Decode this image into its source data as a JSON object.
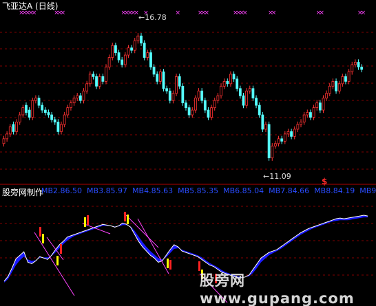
{
  "header": {
    "title": "飞亚达A (日线)"
  },
  "indicator": {
    "title": "股旁网制作",
    "mb_labels": [
      "MB2.86.50",
      "MB3.85.97",
      "MB4.85.63",
      "MB5.85.35",
      "MB6.85.04",
      "MB7.84.66",
      "MB8.84.19",
      "MB9"
    ]
  },
  "annotations": {
    "high": "16.78",
    "low": "11.09",
    "signal": "$"
  },
  "watermark": "股旁网 www.gupang.com",
  "colors": {
    "up": "#ff3333",
    "down": "#55ffff",
    "band_fill": "#1a1aff",
    "band_edge": "#ffffff",
    "signal_bar_red": "#ff2222",
    "signal_bar_yellow": "#ffff00",
    "slope_line": "#ff44ff",
    "marker": "#ff44ff",
    "grid": "#b00000"
  },
  "chart_data": [
    {
      "type": "candlestick",
      "title": "飞亚达A (日线)",
      "ylim": [
        10.7,
        17.6
      ],
      "grid": "dashed horizontal",
      "annotations": [
        {
          "text": "16.78",
          "x_index": 43,
          "y": 16.78
        },
        {
          "text": "11.09",
          "x_index": 83,
          "y": 11.09
        },
        {
          "text": "$",
          "x_index": 102
        }
      ],
      "top_markers_x_index": [
        5,
        6,
        7,
        8,
        9,
        16,
        17,
        18,
        37,
        38,
        39,
        40,
        41,
        44,
        54,
        61,
        62,
        63,
        72,
        73,
        74,
        75,
        83,
        84,
        98,
        99,
        111,
        112
      ],
      "close": [
        12.2,
        12.4,
        12.7,
        12.5,
        12.9,
        13.2,
        13.5,
        13.3,
        13.1,
        13.8,
        13.9,
        13.6,
        13.4,
        13.3,
        13.2,
        13.0,
        12.9,
        12.5,
        12.8,
        13.2,
        13.5,
        13.7,
        13.9,
        14.0,
        13.8,
        14.2,
        14.5,
        14.9,
        14.8,
        14.4,
        14.8,
        14.6,
        15.2,
        15.6,
        16.1,
        15.8,
        15.5,
        15.3,
        15.7,
        16.0,
        15.9,
        16.3,
        16.5,
        16.2,
        15.6,
        15.8,
        15.2,
        14.9,
        14.6,
        15.0,
        14.3,
        14.2,
        13.8,
        14.1,
        14.8,
        14.4,
        13.7,
        13.5,
        13.2,
        13.4,
        13.9,
        14.2,
        13.8,
        13.4,
        13.1,
        13.5,
        13.8,
        14.0,
        14.4,
        14.6,
        14.5,
        14.9,
        14.7,
        14.3,
        14.0,
        13.6,
        14.2,
        14.3,
        13.9,
        13.6,
        13.2,
        12.6,
        12.8,
        11.4,
        11.9,
        12.0,
        12.2,
        12.1,
        12.4,
        12.5,
        12.3,
        12.6,
        12.8,
        12.9,
        13.2,
        13.3,
        13.1,
        13.5,
        13.7,
        13.4,
        13.9,
        14.1,
        14.4,
        14.6,
        14.2,
        14.5,
        14.8,
        14.6,
        15.0,
        15.3,
        15.4,
        15.2,
        15.1
      ],
      "open": [
        12.0,
        12.2,
        12.4,
        12.8,
        12.5,
        12.9,
        13.2,
        13.6,
        13.4,
        13.1,
        13.8,
        13.9,
        13.6,
        13.4,
        13.3,
        13.2,
        13.0,
        12.9,
        12.5,
        12.8,
        13.2,
        13.5,
        13.7,
        13.9,
        14.0,
        13.8,
        14.2,
        14.5,
        14.9,
        14.8,
        14.4,
        14.8,
        14.6,
        15.2,
        15.6,
        16.1,
        15.8,
        15.5,
        15.3,
        15.7,
        16.0,
        15.9,
        16.3,
        16.5,
        16.2,
        15.6,
        15.8,
        15.2,
        14.9,
        14.6,
        15.0,
        14.3,
        14.2,
        13.8,
        14.1,
        14.8,
        14.4,
        13.7,
        13.5,
        13.2,
        13.4,
        13.9,
        14.2,
        13.8,
        13.4,
        13.1,
        13.5,
        13.8,
        14.0,
        14.4,
        14.6,
        14.5,
        14.9,
        14.7,
        14.3,
        14.0,
        13.6,
        14.2,
        14.3,
        13.9,
        13.6,
        13.2,
        12.6,
        12.8,
        11.4,
        11.9,
        12.0,
        12.2,
        12.1,
        12.4,
        12.5,
        12.3,
        12.6,
        12.8,
        12.9,
        13.2,
        13.3,
        13.1,
        13.5,
        13.7,
        13.4,
        13.9,
        14.1,
        14.4,
        14.6,
        14.2,
        14.5,
        14.8,
        14.6,
        15.0,
        15.3,
        15.4,
        15.2
      ]
    },
    {
      "type": "area",
      "title": "股旁网制作",
      "series": [
        {
          "values": [
            3,
            10,
            22,
            35,
            40,
            45,
            30,
            28,
            32,
            38,
            36,
            34,
            40,
            48,
            55,
            60,
            66,
            68,
            70,
            72,
            74,
            76,
            78,
            80,
            82,
            84,
            83,
            82,
            80,
            82,
            86,
            84,
            80,
            70,
            60,
            52,
            46,
            40,
            36,
            30,
            32,
            40,
            48,
            55,
            52,
            46,
            44,
            42,
            40,
            38,
            34,
            30,
            26,
            24,
            20,
            16,
            14,
            12,
            10,
            8,
            8,
            9,
            12,
            20,
            28,
            36,
            40,
            44,
            46,
            48,
            52,
            56,
            60,
            64,
            68,
            72,
            75,
            78,
            80,
            82,
            84,
            86,
            88,
            90,
            92,
            93,
            92,
            93,
            94,
            95,
            96,
            97,
            96
          ]
        },
        {
          "values": [
            1,
            6,
            16,
            26,
            33,
            38,
            34,
            32,
            33,
            36,
            37,
            37,
            39,
            44,
            50,
            56,
            61,
            65,
            68,
            70,
            72,
            74,
            76,
            78,
            80,
            82,
            82,
            82,
            81,
            81,
            83,
            83,
            81,
            75,
            67,
            59,
            52,
            46,
            41,
            36,
            34,
            37,
            43,
            49,
            50,
            48,
            46,
            44,
            42,
            40,
            37,
            33,
            29,
            26,
            23,
            19,
            16,
            14,
            12,
            10,
            9,
            9,
            10,
            15,
            22,
            30,
            35,
            40,
            43,
            46,
            49,
            53,
            57,
            61,
            65,
            69,
            72,
            75,
            78,
            80,
            82,
            84,
            86,
            88,
            89,
            90,
            90,
            90,
            91,
            92,
            93,
            94,
            94
          ]
        }
      ]
    }
  ]
}
